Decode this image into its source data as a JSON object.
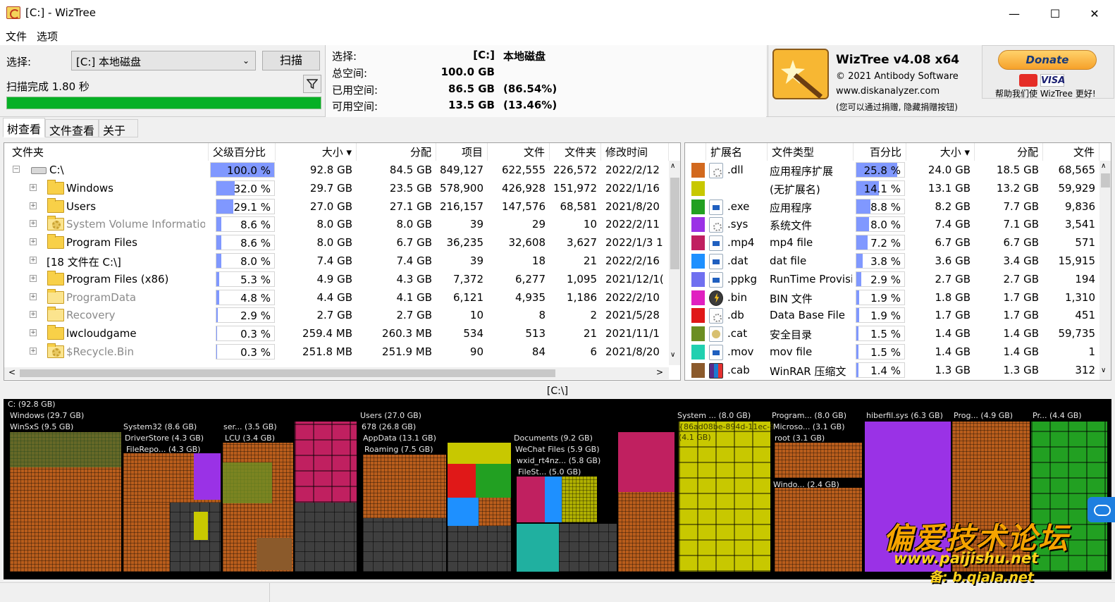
{
  "window": {
    "title": "[C:]  - WizTree",
    "minimize": "—",
    "maximize": "☐",
    "close": "✕"
  },
  "menu": [
    "文件",
    "选项"
  ],
  "scan": {
    "select_label": "选择:",
    "drive": "[C:] 本地磁盘",
    "scan_button": "扫描",
    "status": "扫描完成 1.80 秒",
    "progress": 1.0
  },
  "info": {
    "select_label": "选择:",
    "select_value": "[C:]",
    "select_name": "本地磁盘",
    "total_label": "总空间:",
    "total_value": "100.0 GB",
    "used_label": "已用空间:",
    "used_value": "86.5 GB",
    "used_pct": "(86.54%)",
    "free_label": "可用空间:",
    "free_value": "13.5 GB",
    "free_pct": "(13.46%)"
  },
  "about": {
    "product": "WizTree v4.08 x64",
    "copyright": "© 2021 Antibody Software",
    "website": "www.diskanalyzer.com",
    "note": "(您可以通过捐赠, 隐藏捐赠按钮)"
  },
  "donate": {
    "button": "Donate",
    "visa": "VISA",
    "help": "帮助我们使 WizTree 更好!"
  },
  "tabs": [
    "树查看",
    "文件查看",
    "关于"
  ],
  "tree": {
    "headers": [
      "文件夹",
      "父级百分比",
      "大小 ▾",
      "分配",
      "项目",
      "文件",
      "文件夹",
      "修改时间"
    ],
    "rows": [
      {
        "name": "C:\\",
        "pct": 100.0,
        "pct_label": "100.0 %",
        "size": "92.8 GB",
        "alloc": "84.5 GB",
        "items": "849,127",
        "files": "622,555",
        "folders": "226,572",
        "modified": "2022/2/12"
      },
      {
        "name": "Windows",
        "pct": 32.0,
        "pct_label": "32.0 %",
        "size": "29.7 GB",
        "alloc": "23.5 GB",
        "items": "578,900",
        "files": "426,928",
        "folders": "151,972",
        "modified": "2022/1/16"
      },
      {
        "name": "Users",
        "pct": 29.1,
        "pct_label": "29.1 %",
        "size": "27.0 GB",
        "alloc": "27.1 GB",
        "items": "216,157",
        "files": "147,576",
        "folders": "68,581",
        "modified": "2021/8/20"
      },
      {
        "name": "System Volume Information",
        "pct": 8.6,
        "pct_label": "8.6 %",
        "size": "8.0 GB",
        "alloc": "8.0 GB",
        "items": "39",
        "files": "29",
        "folders": "10",
        "modified": "2022/2/11"
      },
      {
        "name": "Program Files",
        "pct": 8.6,
        "pct_label": "8.6 %",
        "size": "8.0 GB",
        "alloc": "6.7 GB",
        "items": "36,235",
        "files": "32,608",
        "folders": "3,627",
        "modified": "2022/1/3 1"
      },
      {
        "name": "[18 文件在 C:\\]",
        "pct": 8.0,
        "pct_label": "8.0 %",
        "size": "7.4 GB",
        "alloc": "7.4 GB",
        "items": "39",
        "files": "18",
        "folders": "21",
        "modified": "2022/2/16"
      },
      {
        "name": "Program Files (x86)",
        "pct": 5.3,
        "pct_label": "5.3 %",
        "size": "4.9 GB",
        "alloc": "4.3 GB",
        "items": "7,372",
        "files": "6,277",
        "folders": "1,095",
        "modified": "2021/12/1("
      },
      {
        "name": "ProgramData",
        "pct": 4.8,
        "pct_label": "4.8 %",
        "size": "4.4 GB",
        "alloc": "4.1 GB",
        "items": "6,121",
        "files": "4,935",
        "folders": "1,186",
        "modified": "2022/2/10"
      },
      {
        "name": "Recovery",
        "pct": 2.9,
        "pct_label": "2.9 %",
        "size": "2.7 GB",
        "alloc": "2.7 GB",
        "items": "10",
        "files": "8",
        "folders": "2",
        "modified": "2021/5/28"
      },
      {
        "name": "lwcloudgame",
        "pct": 0.3,
        "pct_label": "0.3 %",
        "size": "259.4 MB",
        "alloc": "260.3 MB",
        "items": "534",
        "files": "513",
        "folders": "21",
        "modified": "2021/11/1"
      },
      {
        "name": "$Recycle.Bin",
        "pct": 0.3,
        "pct_label": "0.3 %",
        "size": "251.8 MB",
        "alloc": "251.9 MB",
        "items": "90",
        "files": "84",
        "folders": "6",
        "modified": "2021/8/20"
      }
    ]
  },
  "extensions": {
    "headers": [
      "扩展名",
      "文件类型",
      "百分比",
      "大小 ▾",
      "分配",
      "文件"
    ],
    "rows": [
      {
        "color": "#d2691e",
        "ext": ".dll",
        "type": "应用程序扩展",
        "pct": 25.8,
        "pct_label": "25.8 %",
        "size": "24.0 GB",
        "alloc": "18.5 GB",
        "files": "68,565"
      },
      {
        "color": "#c8c800",
        "ext": "",
        "type": "(无扩展名)",
        "pct": 14.1,
        "pct_label": "14.1 %",
        "size": "13.1 GB",
        "alloc": "13.2 GB",
        "files": "59,929"
      },
      {
        "color": "#22a022",
        "ext": ".exe",
        "type": "应用程序",
        "pct": 8.8,
        "pct_label": "8.8 %",
        "size": "8.2 GB",
        "alloc": "7.7 GB",
        "files": "9,836"
      },
      {
        "color": "#9a32e6",
        "ext": ".sys",
        "type": "系统文件",
        "pct": 8.0,
        "pct_label": "8.0 %",
        "size": "7.4 GB",
        "alloc": "7.1 GB",
        "files": "3,541"
      },
      {
        "color": "#c02060",
        "ext": ".mp4",
        "type": "mp4 file",
        "pct": 7.2,
        "pct_label": "7.2 %",
        "size": "6.7 GB",
        "alloc": "6.7 GB",
        "files": "571"
      },
      {
        "color": "#1e90ff",
        "ext": ".dat",
        "type": "dat file",
        "pct": 3.8,
        "pct_label": "3.8 %",
        "size": "3.6 GB",
        "alloc": "3.4 GB",
        "files": "15,915"
      },
      {
        "color": "#7070f0",
        "ext": ".ppkg",
        "type": "RunTime Provisi",
        "pct": 2.9,
        "pct_label": "2.9 %",
        "size": "2.7 GB",
        "alloc": "2.7 GB",
        "files": "194"
      },
      {
        "color": "#e020c0",
        "ext": ".bin",
        "type": "BIN 文件",
        "pct": 1.9,
        "pct_label": "1.9 %",
        "size": "1.8 GB",
        "alloc": "1.7 GB",
        "files": "1,310"
      },
      {
        "color": "#e01818",
        "ext": ".db",
        "type": "Data Base File",
        "pct": 1.9,
        "pct_label": "1.9 %",
        "size": "1.7 GB",
        "alloc": "1.7 GB",
        "files": "451"
      },
      {
        "color": "#6b8e23",
        "ext": ".cat",
        "type": "安全目录",
        "pct": 1.5,
        "pct_label": "1.5 %",
        "size": "1.4 GB",
        "alloc": "1.4 GB",
        "files": "59,735"
      },
      {
        "color": "#20d0b0",
        "ext": ".mov",
        "type": "mov file",
        "pct": 1.5,
        "pct_label": "1.5 %",
        "size": "1.4 GB",
        "alloc": "1.4 GB",
        "files": "1"
      },
      {
        "color": "#8b5a2b",
        "ext": ".cab",
        "type": "WinRAR 压缩文",
        "pct": 1.4,
        "pct_label": "1.4 %",
        "size": "1.3 GB",
        "alloc": "1.3 GB",
        "files": "312"
      }
    ]
  },
  "treemap": {
    "path": "[C:\\]",
    "labels": {
      "root": "C: (92.8 GB)",
      "windows": "Windows (29.7 GB)",
      "winsxs": "WinSxS (9.5 GB)",
      "system32": "System32 (8.6 GB)",
      "driverstore": "DriverStore (4.3 GB)",
      "filerepo": "FileRepo... (4.3 GB)",
      "ser": "ser... (3.5 GB)",
      "lcu": "LCU (3.4 GB)",
      "users": "Users (27.0 GB)",
      "u678": "678 (26.8 GB)",
      "appdata": "AppData (13.1 GB)",
      "roaming": "Roaming (7.5 GB)",
      "documents": "Documents (9.2 GB)",
      "wechat": "WeChat Files (5.9 GB)",
      "wxid": "wxid_rt4nz... (5.8 GB)",
      "filest": "FileSt... (5.0 GB)",
      "system": "System ... (8.0 GB)",
      "guid": "{86ad08be-894d-11ec-9",
      "guid_size": "(4.1 GB)",
      "program": "Program... (8.0 GB)",
      "microso": "Microso... (3.1 GB)",
      "rootdir": "root (3.1 GB)",
      "windo": "Windo... (2.4 GB)",
      "hiberfil": "hiberfil.sys (6.3 GB)",
      "prog": "Prog... (4.9 GB)",
      "pr": "Pr... (4.4 GB)"
    }
  },
  "watermark": {
    "title": "偏爱技术论坛",
    "url": "www.paijishu.net",
    "sub": "备: b.qiala.net"
  }
}
